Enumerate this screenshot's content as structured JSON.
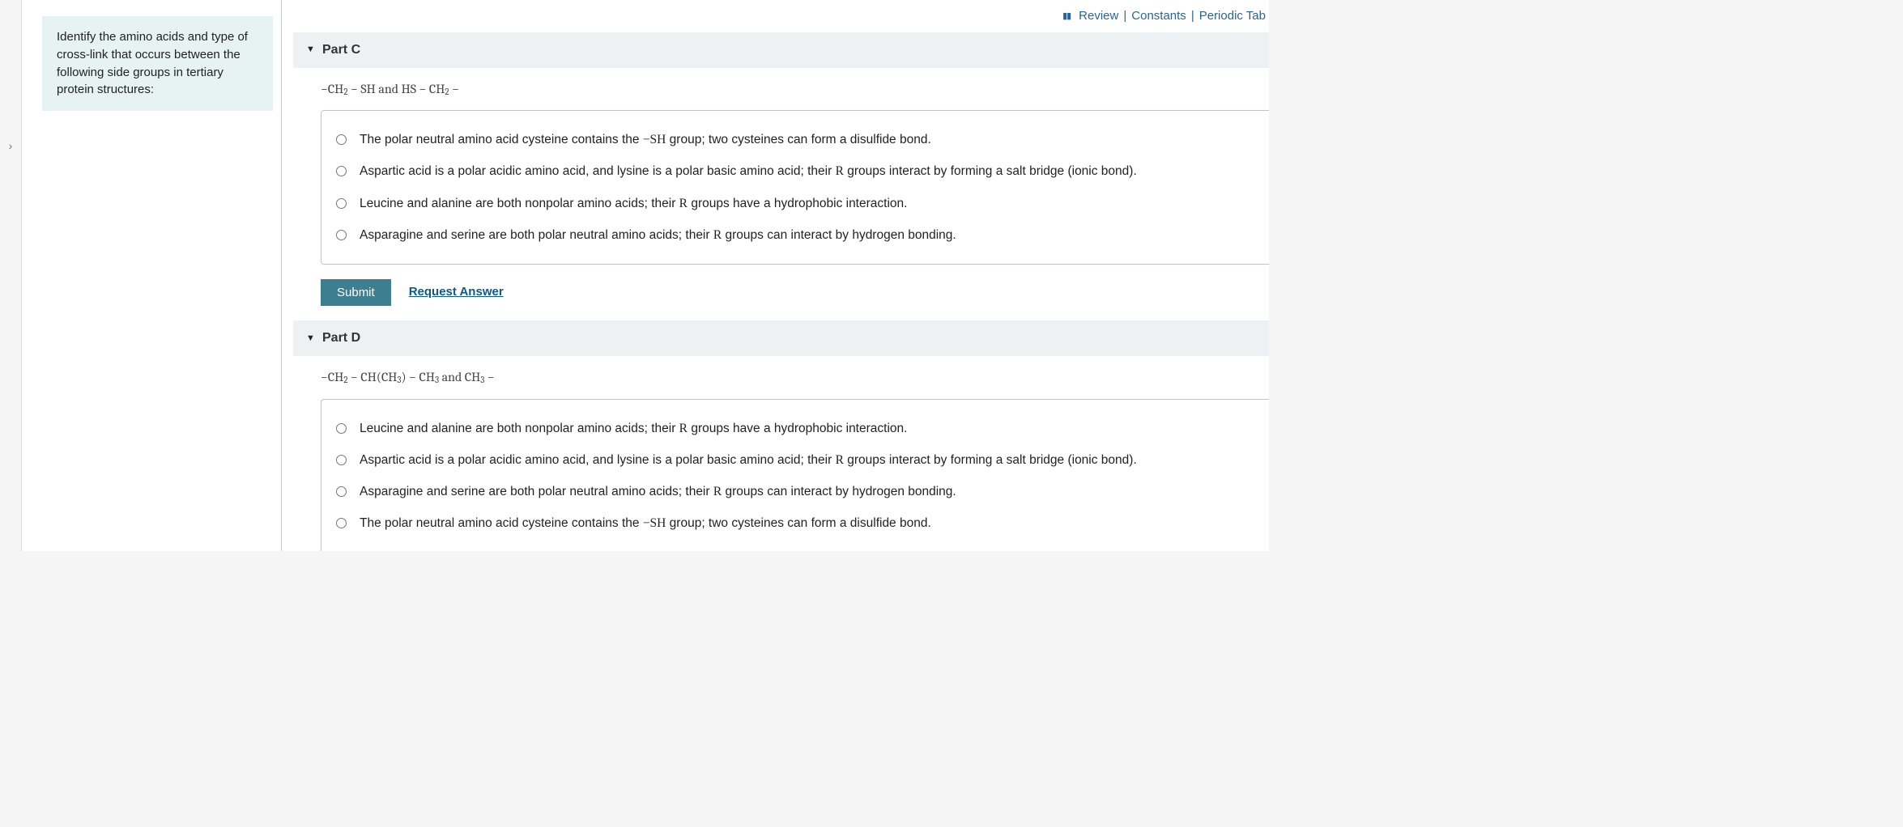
{
  "instruction": "Identify the amino acids and type of cross-link that occurs between the following side groups in tertiary protein structures:",
  "top_links": {
    "review": "Review",
    "constants": "Constants",
    "periodic": "Periodic Tab"
  },
  "parts": [
    {
      "label": "Part C",
      "formula_html": "−CH<sub>2</sub> − SH and HS − CH<sub>2</sub> −",
      "options": [
        {
          "pre": "The polar neutral amino acid cysteine contains the ",
          "chem": "−SH",
          "post": " group; two cysteines can form a disulfide bond."
        },
        {
          "pre": "Aspartic acid is a polar acidic amino acid, and lysine is a polar basic amino acid; their ",
          "chem": "R",
          "post": " groups interact by forming a salt bridge (ionic bond)."
        },
        {
          "pre": "Leucine and alanine are both nonpolar amino acids; their ",
          "chem": "R",
          "post": " groups have a hydrophobic interaction."
        },
        {
          "pre": "Asparagine and serine are both polar neutral amino acids; their ",
          "chem": "R",
          "post": " groups can interact by hydrogen bonding."
        }
      ]
    },
    {
      "label": "Part D",
      "formula_html": "−CH<sub>2</sub> − CH(CH<sub>3</sub>) − CH<sub>3</sub> and CH<sub>3</sub> −",
      "options": [
        {
          "pre": "Leucine and alanine are both nonpolar amino acids; their ",
          "chem": "R",
          "post": " groups have a hydrophobic interaction."
        },
        {
          "pre": "Aspartic acid is a polar acidic amino acid, and lysine is a polar basic amino acid; their ",
          "chem": "R",
          "post": " groups interact by forming a salt bridge (ionic bond)."
        },
        {
          "pre": "Asparagine and serine are both polar neutral amino acids; their ",
          "chem": "R",
          "post": " groups can interact by hydrogen bonding."
        },
        {
          "pre": "The polar neutral amino acid cysteine contains the ",
          "chem": "−SH",
          "post": " group; two cysteines can form a disulfide bond."
        }
      ]
    }
  ],
  "buttons": {
    "submit": "Submit",
    "request": "Request Answer"
  }
}
